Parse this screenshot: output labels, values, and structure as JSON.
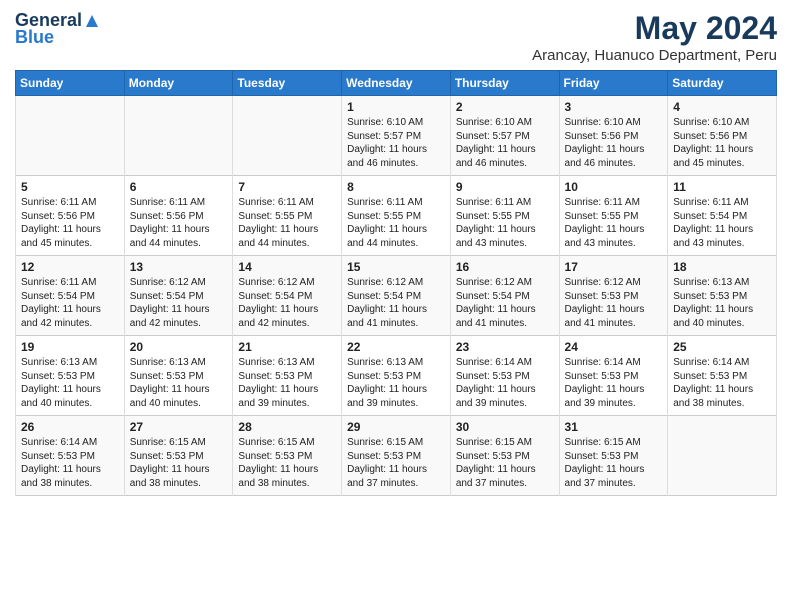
{
  "header": {
    "logo_general": "General",
    "logo_blue": "Blue",
    "title": "May 2024",
    "location": "Arancay, Huanuco Department, Peru"
  },
  "days_of_week": [
    "Sunday",
    "Monday",
    "Tuesday",
    "Wednesday",
    "Thursday",
    "Friday",
    "Saturday"
  ],
  "weeks": [
    [
      {
        "day": "",
        "content": ""
      },
      {
        "day": "",
        "content": ""
      },
      {
        "day": "",
        "content": ""
      },
      {
        "day": "1",
        "content": "Sunrise: 6:10 AM\nSunset: 5:57 PM\nDaylight: 11 hours\nand 46 minutes."
      },
      {
        "day": "2",
        "content": "Sunrise: 6:10 AM\nSunset: 5:57 PM\nDaylight: 11 hours\nand 46 minutes."
      },
      {
        "day": "3",
        "content": "Sunrise: 6:10 AM\nSunset: 5:56 PM\nDaylight: 11 hours\nand 46 minutes."
      },
      {
        "day": "4",
        "content": "Sunrise: 6:10 AM\nSunset: 5:56 PM\nDaylight: 11 hours\nand 45 minutes."
      }
    ],
    [
      {
        "day": "5",
        "content": "Sunrise: 6:11 AM\nSunset: 5:56 PM\nDaylight: 11 hours\nand 45 minutes."
      },
      {
        "day": "6",
        "content": "Sunrise: 6:11 AM\nSunset: 5:56 PM\nDaylight: 11 hours\nand 44 minutes."
      },
      {
        "day": "7",
        "content": "Sunrise: 6:11 AM\nSunset: 5:55 PM\nDaylight: 11 hours\nand 44 minutes."
      },
      {
        "day": "8",
        "content": "Sunrise: 6:11 AM\nSunset: 5:55 PM\nDaylight: 11 hours\nand 44 minutes."
      },
      {
        "day": "9",
        "content": "Sunrise: 6:11 AM\nSunset: 5:55 PM\nDaylight: 11 hours\nand 43 minutes."
      },
      {
        "day": "10",
        "content": "Sunrise: 6:11 AM\nSunset: 5:55 PM\nDaylight: 11 hours\nand 43 minutes."
      },
      {
        "day": "11",
        "content": "Sunrise: 6:11 AM\nSunset: 5:54 PM\nDaylight: 11 hours\nand 43 minutes."
      }
    ],
    [
      {
        "day": "12",
        "content": "Sunrise: 6:11 AM\nSunset: 5:54 PM\nDaylight: 11 hours\nand 42 minutes."
      },
      {
        "day": "13",
        "content": "Sunrise: 6:12 AM\nSunset: 5:54 PM\nDaylight: 11 hours\nand 42 minutes."
      },
      {
        "day": "14",
        "content": "Sunrise: 6:12 AM\nSunset: 5:54 PM\nDaylight: 11 hours\nand 42 minutes."
      },
      {
        "day": "15",
        "content": "Sunrise: 6:12 AM\nSunset: 5:54 PM\nDaylight: 11 hours\nand 41 minutes."
      },
      {
        "day": "16",
        "content": "Sunrise: 6:12 AM\nSunset: 5:54 PM\nDaylight: 11 hours\nand 41 minutes."
      },
      {
        "day": "17",
        "content": "Sunrise: 6:12 AM\nSunset: 5:53 PM\nDaylight: 11 hours\nand 41 minutes."
      },
      {
        "day": "18",
        "content": "Sunrise: 6:13 AM\nSunset: 5:53 PM\nDaylight: 11 hours\nand 40 minutes."
      }
    ],
    [
      {
        "day": "19",
        "content": "Sunrise: 6:13 AM\nSunset: 5:53 PM\nDaylight: 11 hours\nand 40 minutes."
      },
      {
        "day": "20",
        "content": "Sunrise: 6:13 AM\nSunset: 5:53 PM\nDaylight: 11 hours\nand 40 minutes."
      },
      {
        "day": "21",
        "content": "Sunrise: 6:13 AM\nSunset: 5:53 PM\nDaylight: 11 hours\nand 39 minutes."
      },
      {
        "day": "22",
        "content": "Sunrise: 6:13 AM\nSunset: 5:53 PM\nDaylight: 11 hours\nand 39 minutes."
      },
      {
        "day": "23",
        "content": "Sunrise: 6:14 AM\nSunset: 5:53 PM\nDaylight: 11 hours\nand 39 minutes."
      },
      {
        "day": "24",
        "content": "Sunrise: 6:14 AM\nSunset: 5:53 PM\nDaylight: 11 hours\nand 39 minutes."
      },
      {
        "day": "25",
        "content": "Sunrise: 6:14 AM\nSunset: 5:53 PM\nDaylight: 11 hours\nand 38 minutes."
      }
    ],
    [
      {
        "day": "26",
        "content": "Sunrise: 6:14 AM\nSunset: 5:53 PM\nDaylight: 11 hours\nand 38 minutes."
      },
      {
        "day": "27",
        "content": "Sunrise: 6:15 AM\nSunset: 5:53 PM\nDaylight: 11 hours\nand 38 minutes."
      },
      {
        "day": "28",
        "content": "Sunrise: 6:15 AM\nSunset: 5:53 PM\nDaylight: 11 hours\nand 38 minutes."
      },
      {
        "day": "29",
        "content": "Sunrise: 6:15 AM\nSunset: 5:53 PM\nDaylight: 11 hours\nand 37 minutes."
      },
      {
        "day": "30",
        "content": "Sunrise: 6:15 AM\nSunset: 5:53 PM\nDaylight: 11 hours\nand 37 minutes."
      },
      {
        "day": "31",
        "content": "Sunrise: 6:15 AM\nSunset: 5:53 PM\nDaylight: 11 hours\nand 37 minutes."
      },
      {
        "day": "",
        "content": ""
      }
    ]
  ]
}
